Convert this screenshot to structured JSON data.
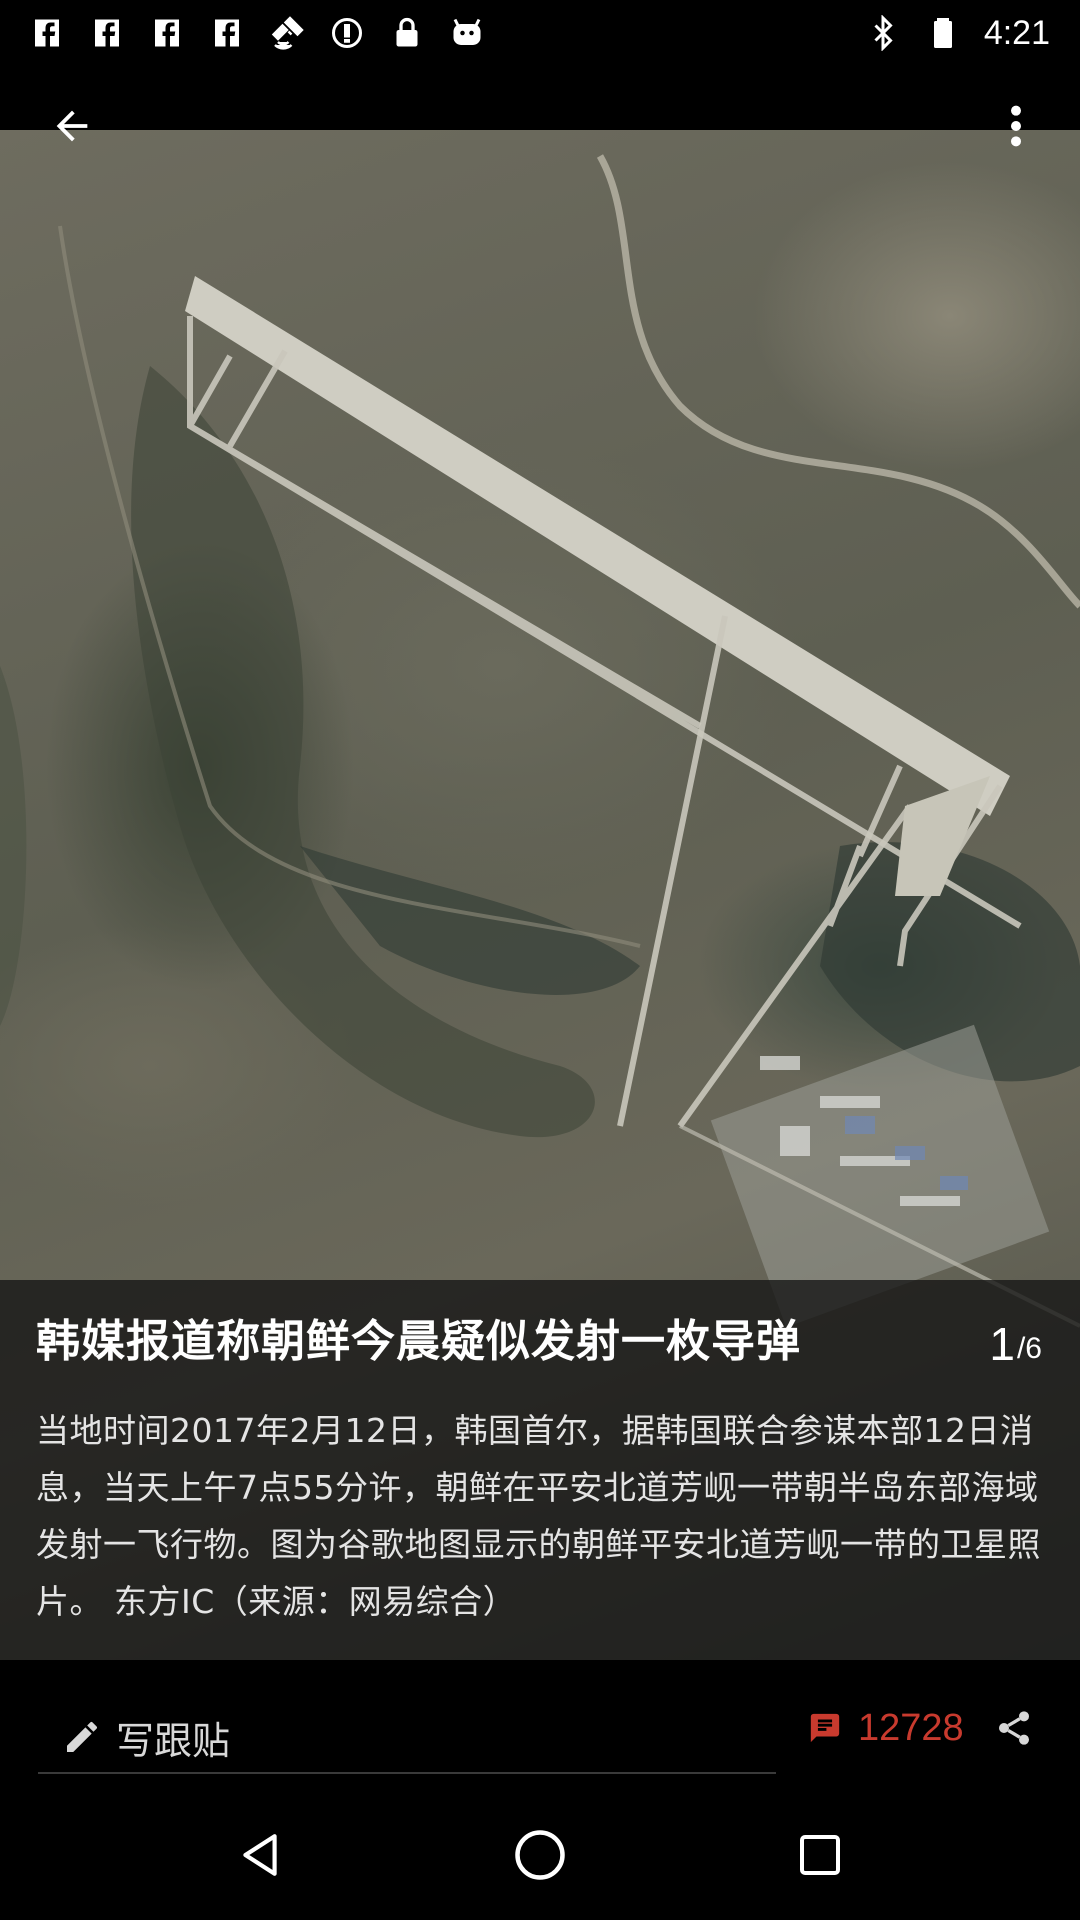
{
  "status_bar": {
    "time": "4:21",
    "left_icons": [
      "facebook-icon",
      "facebook-icon",
      "facebook-icon",
      "facebook-icon",
      "fake-gps-icon",
      "sync-icon",
      "lock-icon",
      "android-icon"
    ],
    "right_icons": [
      "bluetooth-icon",
      "battery-icon"
    ]
  },
  "toolbar": {
    "back_icon": "arrow-back-icon",
    "more_icon": "more-vert-icon"
  },
  "caption": {
    "title": "韩媒报道称朝鲜今晨疑似发射一枚导弹",
    "page_current": "1",
    "page_total": "/6",
    "body": "当地时间2017年2月12日，韩国首尔，据韩国联合参谋本部12日消息，当天上午7点55分许，朝鲜在平安北道芳岘一带朝半岛东部海域发射一飞行物。图为谷歌地图显示的朝鲜平安北道芳岘一带的卫星照片。 东方IC（来源：网易综合）"
  },
  "action_bar": {
    "reply_label": "写跟贴",
    "comment_count": "12728",
    "comment_color": "#c83a2e"
  },
  "nav_bar": {
    "icons": [
      "back-triangle-icon",
      "home-circle-icon",
      "recents-square-icon"
    ]
  }
}
